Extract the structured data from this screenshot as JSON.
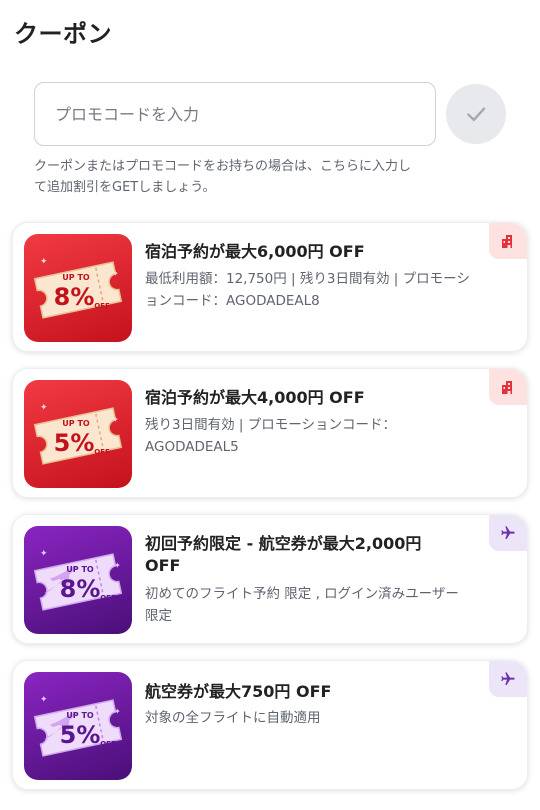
{
  "header": {
    "title": "クーポン"
  },
  "promo": {
    "placeholder": "プロモコードを入力",
    "helper_line1": "クーポンまたはプロモコードをお持ちの場合は、こちらに入力し",
    "helper_line2": "て追加割引をGETしましょう。"
  },
  "icons": {
    "apply": "check-icon",
    "hotel": "hotel-building-icon",
    "flight": "airplane-icon"
  },
  "colors": {
    "hotel_badge_from": "#f0363f",
    "hotel_badge_to": "#c4121d",
    "flight_badge_from": "#7d1fb4",
    "flight_badge_to": "#4a0f78",
    "hotel_tag_bg": "#fde2e1",
    "hotel_tag_icon": "#e5323a",
    "flight_tag_bg": "#ece5f7",
    "flight_tag_icon": "#6f2fb1"
  },
  "coupons": [
    {
      "category": "hotel",
      "badge_top": "UP TO",
      "badge_percent": "8%",
      "badge_off": "OFF",
      "title_lines": [
        "宿泊予約が最大6,000円 OFF"
      ],
      "desc_lines": [
        "最低利用額：12,750円 | 残り3日間有効 | プロモーシ",
        "ョンコード：AGODADEAL8"
      ]
    },
    {
      "category": "hotel",
      "badge_top": "UP TO",
      "badge_percent": "5%",
      "badge_off": "OFF",
      "title_lines": [
        "宿泊予約が最大4,000円 OFF"
      ],
      "desc_lines": [
        "残り3日間有効 | プロモーションコード：",
        "AGODADEAL5"
      ]
    },
    {
      "category": "flight",
      "badge_top": "UP TO",
      "badge_percent": "8%",
      "badge_off": "OFF",
      "title_lines": [
        "初回予約限定 - 航空券が最大2,000円",
        "OFF"
      ],
      "desc_lines": [
        "初めてのフライト予約 限定 , ログイン済みユーザー",
        "限定"
      ]
    },
    {
      "category": "flight",
      "badge_top": "UP TO",
      "badge_percent": "5%",
      "badge_off": "OFF",
      "title_lines": [
        "航空券が最大750円 OFF"
      ],
      "desc_lines": [
        "対象の全フライトに自動適用"
      ]
    }
  ]
}
